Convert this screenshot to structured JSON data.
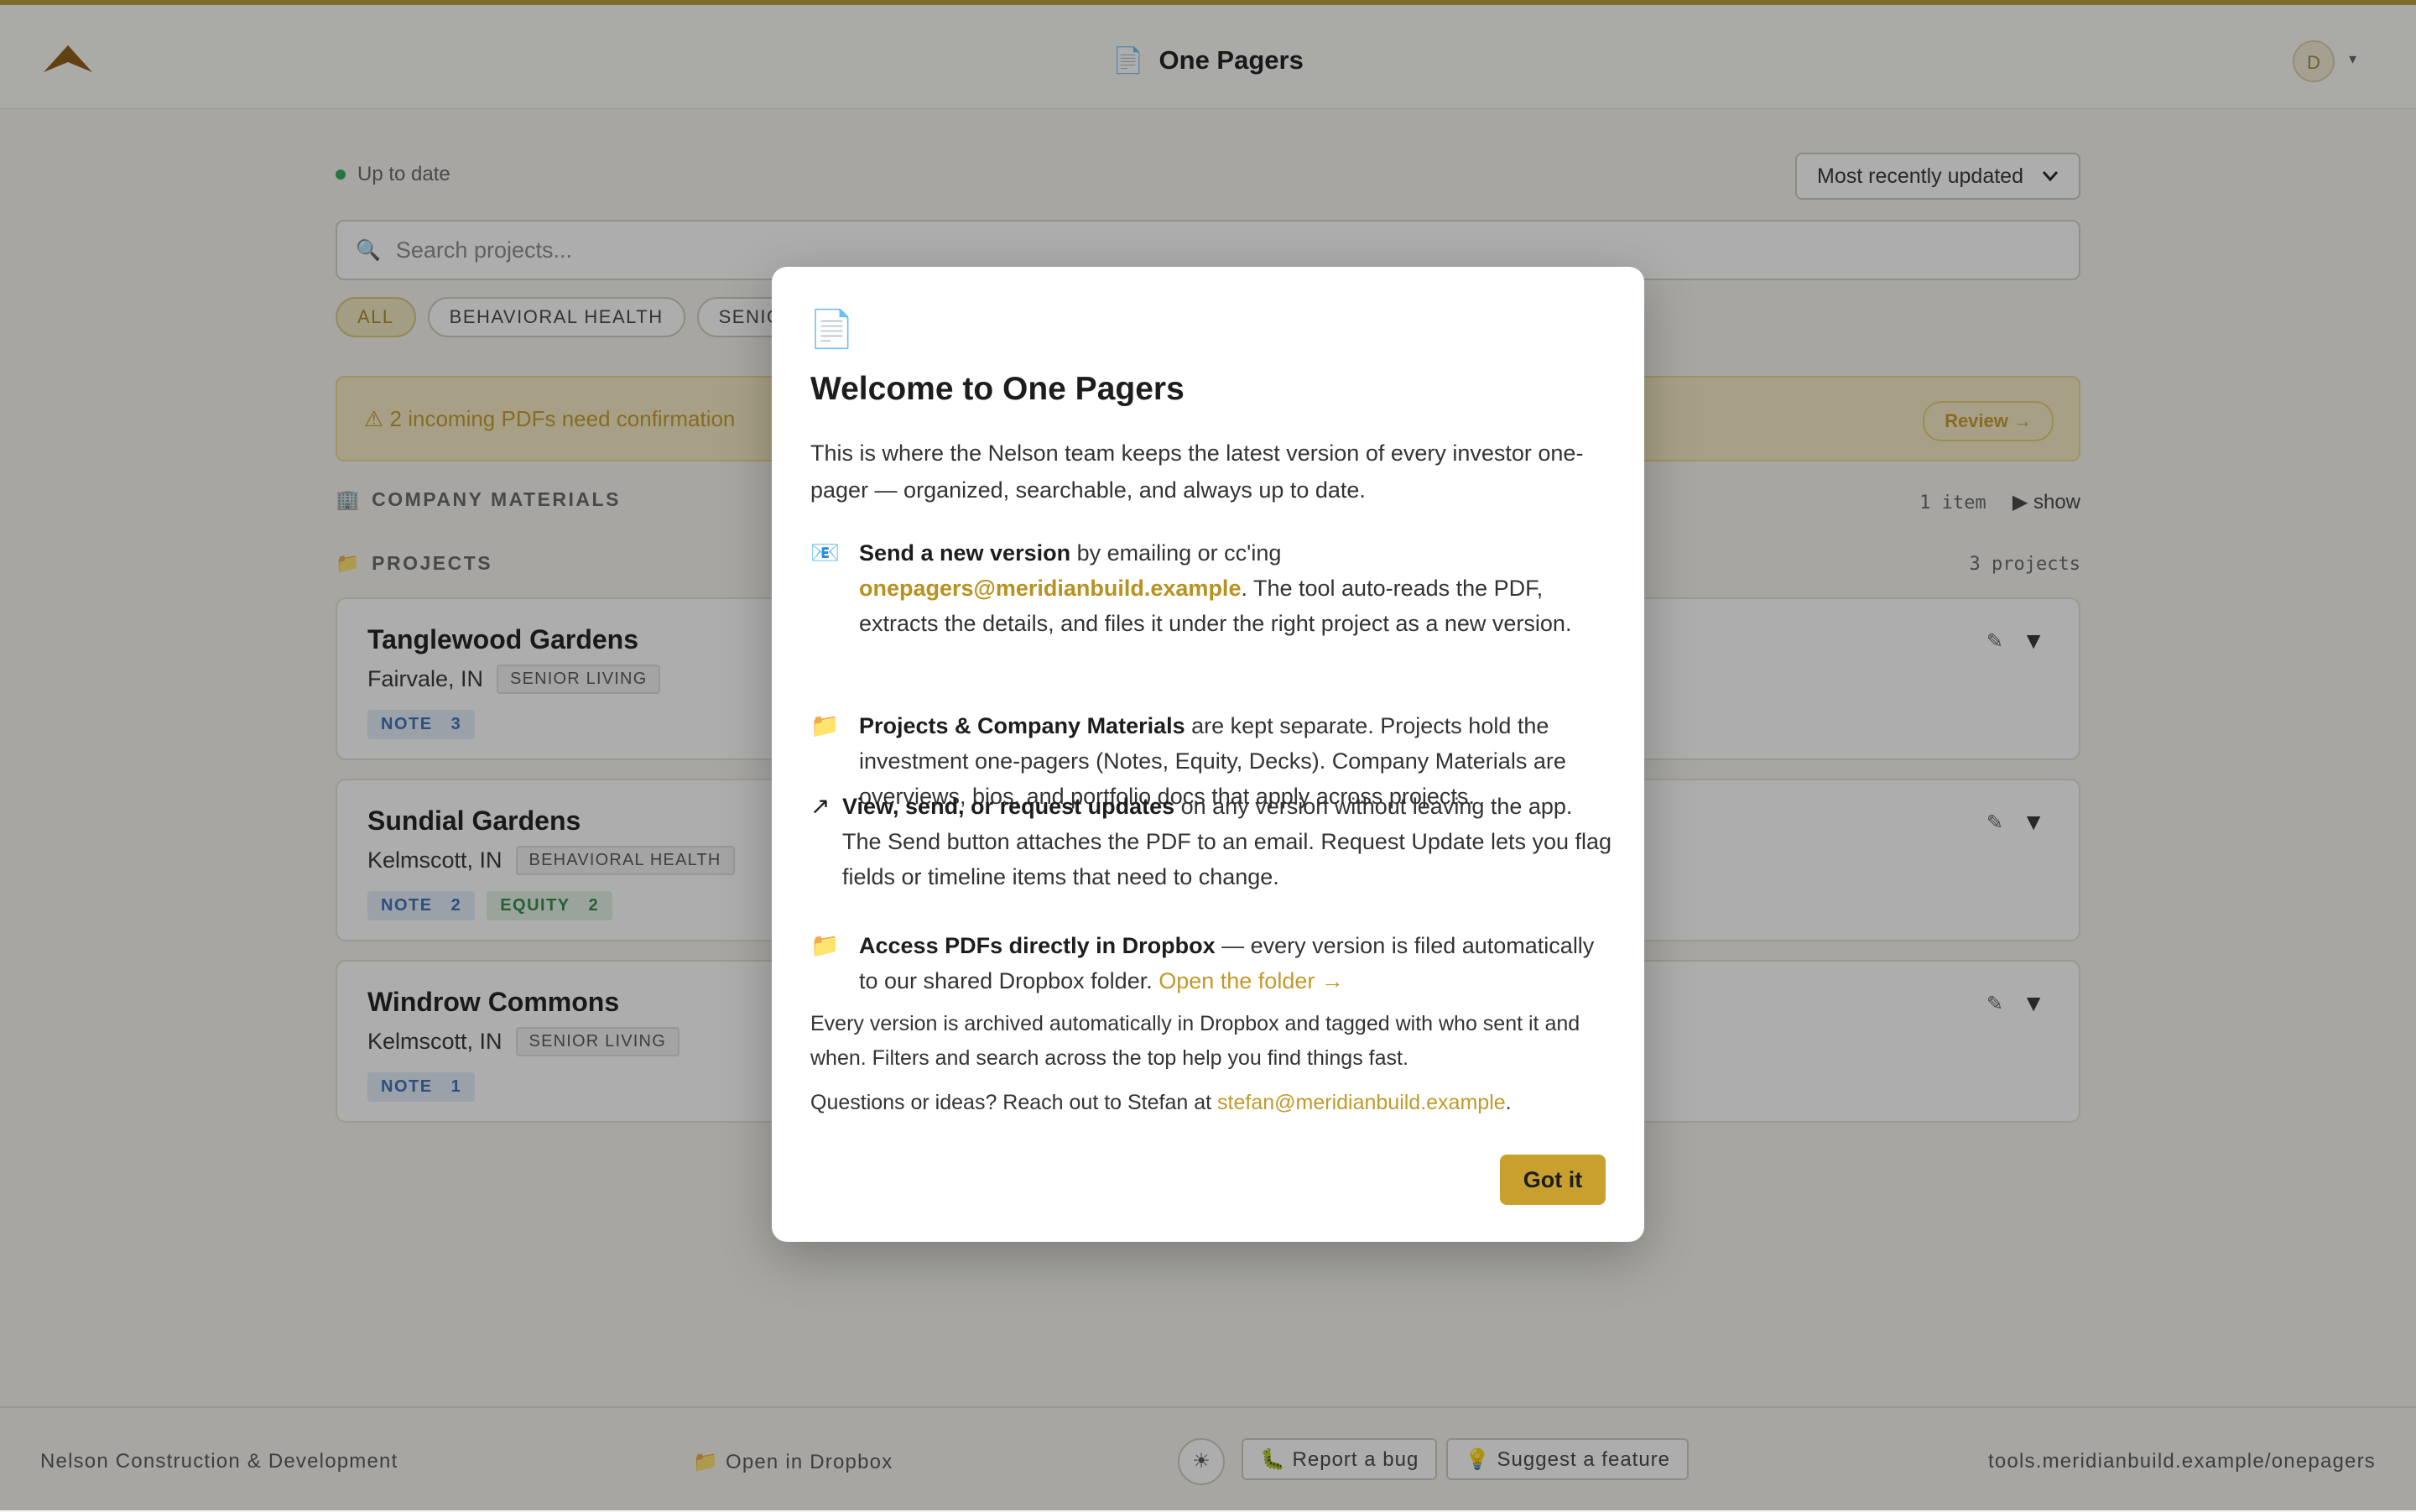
{
  "header": {
    "title": "One Pagers",
    "avatar_initial": "D",
    "caret": "▾"
  },
  "toolbar": {
    "status": "Up to date",
    "sort_selected": "Most recently updated",
    "search_placeholder": "Search projects..."
  },
  "filters": [
    "ALL",
    "BEHAVIORAL HEALTH",
    "SENIO"
  ],
  "alert": {
    "text": "⚠ 2 incoming PDFs need confirmation",
    "button": "Review →"
  },
  "sections": {
    "company": {
      "label": "COMPANY MATERIALS",
      "count": "1 item",
      "toggle": "▶ show"
    },
    "projects": {
      "label": "PROJECTS",
      "count": "3 projects"
    }
  },
  "projects": [
    {
      "name": "Tanglewood Gardens",
      "location": "Fairvale, IN",
      "tag": "SENIOR LIVING",
      "badges": [
        {
          "label": "NOTE",
          "count": "3",
          "kind": "note"
        }
      ]
    },
    {
      "name": "Sundial Gardens",
      "location": "Kelmscott, IN",
      "tag": "BEHAVIORAL HEALTH",
      "badges": [
        {
          "label": "NOTE",
          "count": "2",
          "kind": "note"
        },
        {
          "label": "EQUITY",
          "count": "2",
          "kind": "equity"
        }
      ]
    },
    {
      "name": "Windrow Commons",
      "location": "Kelmscott, IN",
      "tag": "SENIOR LIVING",
      "badges": [
        {
          "label": "NOTE",
          "count": "1",
          "kind": "note"
        }
      ]
    }
  ],
  "footer": {
    "company": "Nelson Construction & Development",
    "dropbox": "📁 Open in Dropbox",
    "theme_icon": "☀",
    "bug": "🐛 Report a bug",
    "feature": "💡 Suggest a feature",
    "url": "tools.meridianbuild.example/onepagers"
  },
  "modal": {
    "title": "Welcome to One Pagers",
    "intro": "This is where the Nelson team keeps the latest version of every investor one-pager — organized, searchable, and always up to date.",
    "item1": {
      "bold": "Send a new version",
      "pre": " by emailing or cc'ing ",
      "email": "onepagers@meridianbuild.example",
      "post": ". The tool auto-reads the PDF, extracts the details, and files it under the right project as a new version."
    },
    "item2": {
      "bold": "Projects & Company Materials",
      "text": " are kept separate. Projects hold the investment one-pagers (Notes, Equity, Decks). Company Materials are overviews, bios, and portfolio docs that apply across projects."
    },
    "item3": {
      "bold": "View, send, or request updates",
      "text": " on any version without leaving the app. The Send button attaches the PDF to an email. Request Update lets you flag fields or timeline items that need to change."
    },
    "item4": {
      "bold": "Access PDFs directly in Dropbox",
      "text": " — every version is filed automatically to our shared Dropbox folder. ",
      "link": "Open the folder →"
    },
    "archive": "Every version is archived automatically in Dropbox and tagged with who sent it and when. Filters and search across the top help you find things fast.",
    "contact_pre": "Questions or ideas? Reach out to Stefan at ",
    "contact_email": "stefan@meridianbuild.example",
    "contact_post": ".",
    "button": "Got it"
  }
}
